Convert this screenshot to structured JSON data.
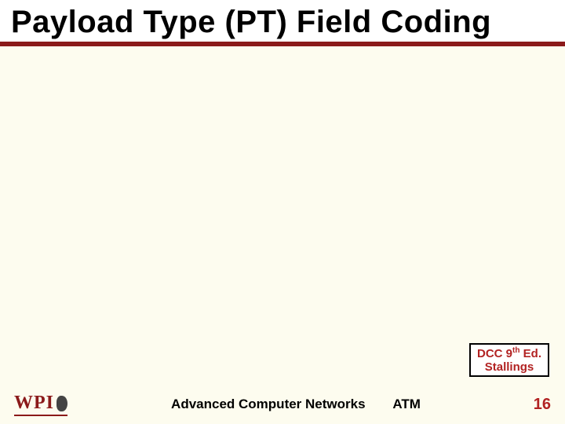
{
  "title": "Payload Type (PT) Field Coding",
  "citation": {
    "line1_pre": "DCC 9",
    "line1_sup": "th",
    "line1_post": " Ed.",
    "line2": "Stallings"
  },
  "footer": {
    "logo_text": "WPI",
    "course": "Advanced Computer Networks",
    "topic": "ATM",
    "page": "16"
  }
}
